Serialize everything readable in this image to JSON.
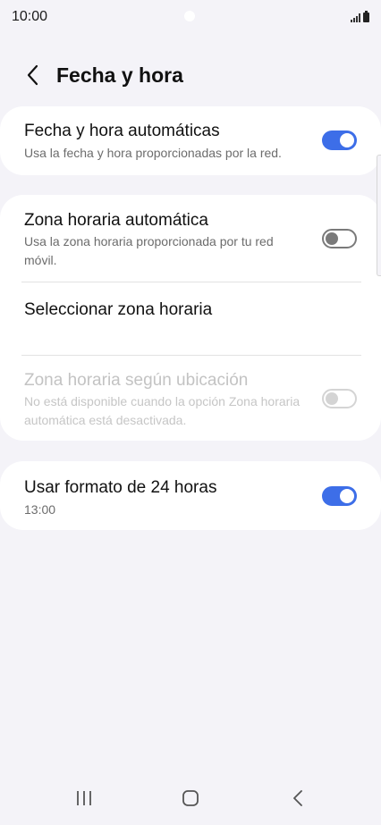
{
  "status_bar": {
    "time": "10:00"
  },
  "header": {
    "back_icon": "chevron-left-icon",
    "title": "Fecha y hora"
  },
  "settings": {
    "auto_datetime": {
      "title": "Fecha y hora automáticas",
      "subtitle": "Usa la fecha y hora proporcionadas por la red.",
      "enabled": true
    },
    "auto_timezone": {
      "title": "Zona horaria automática",
      "subtitle": "Usa la zona horaria proporcionada por tu red móvil.",
      "enabled": false
    },
    "select_timezone": {
      "title": "Seleccionar zona horaria"
    },
    "location_timezone": {
      "title": "Zona horaria según ubicación",
      "subtitle": "No está disponible cuando la opción Zona horaria automática está desactivada.",
      "enabled": false,
      "disabled": true
    },
    "format_24h": {
      "title": "Usar formato de 24 horas",
      "subtitle": "13:00",
      "enabled": true
    }
  },
  "colors": {
    "background": "#f4f3f8",
    "card": "#ffffff",
    "accent": "#3d6ee8"
  },
  "nav_bar": {
    "recents_icon": "recents-icon",
    "home_icon": "home-icon",
    "back_icon": "back-icon"
  }
}
